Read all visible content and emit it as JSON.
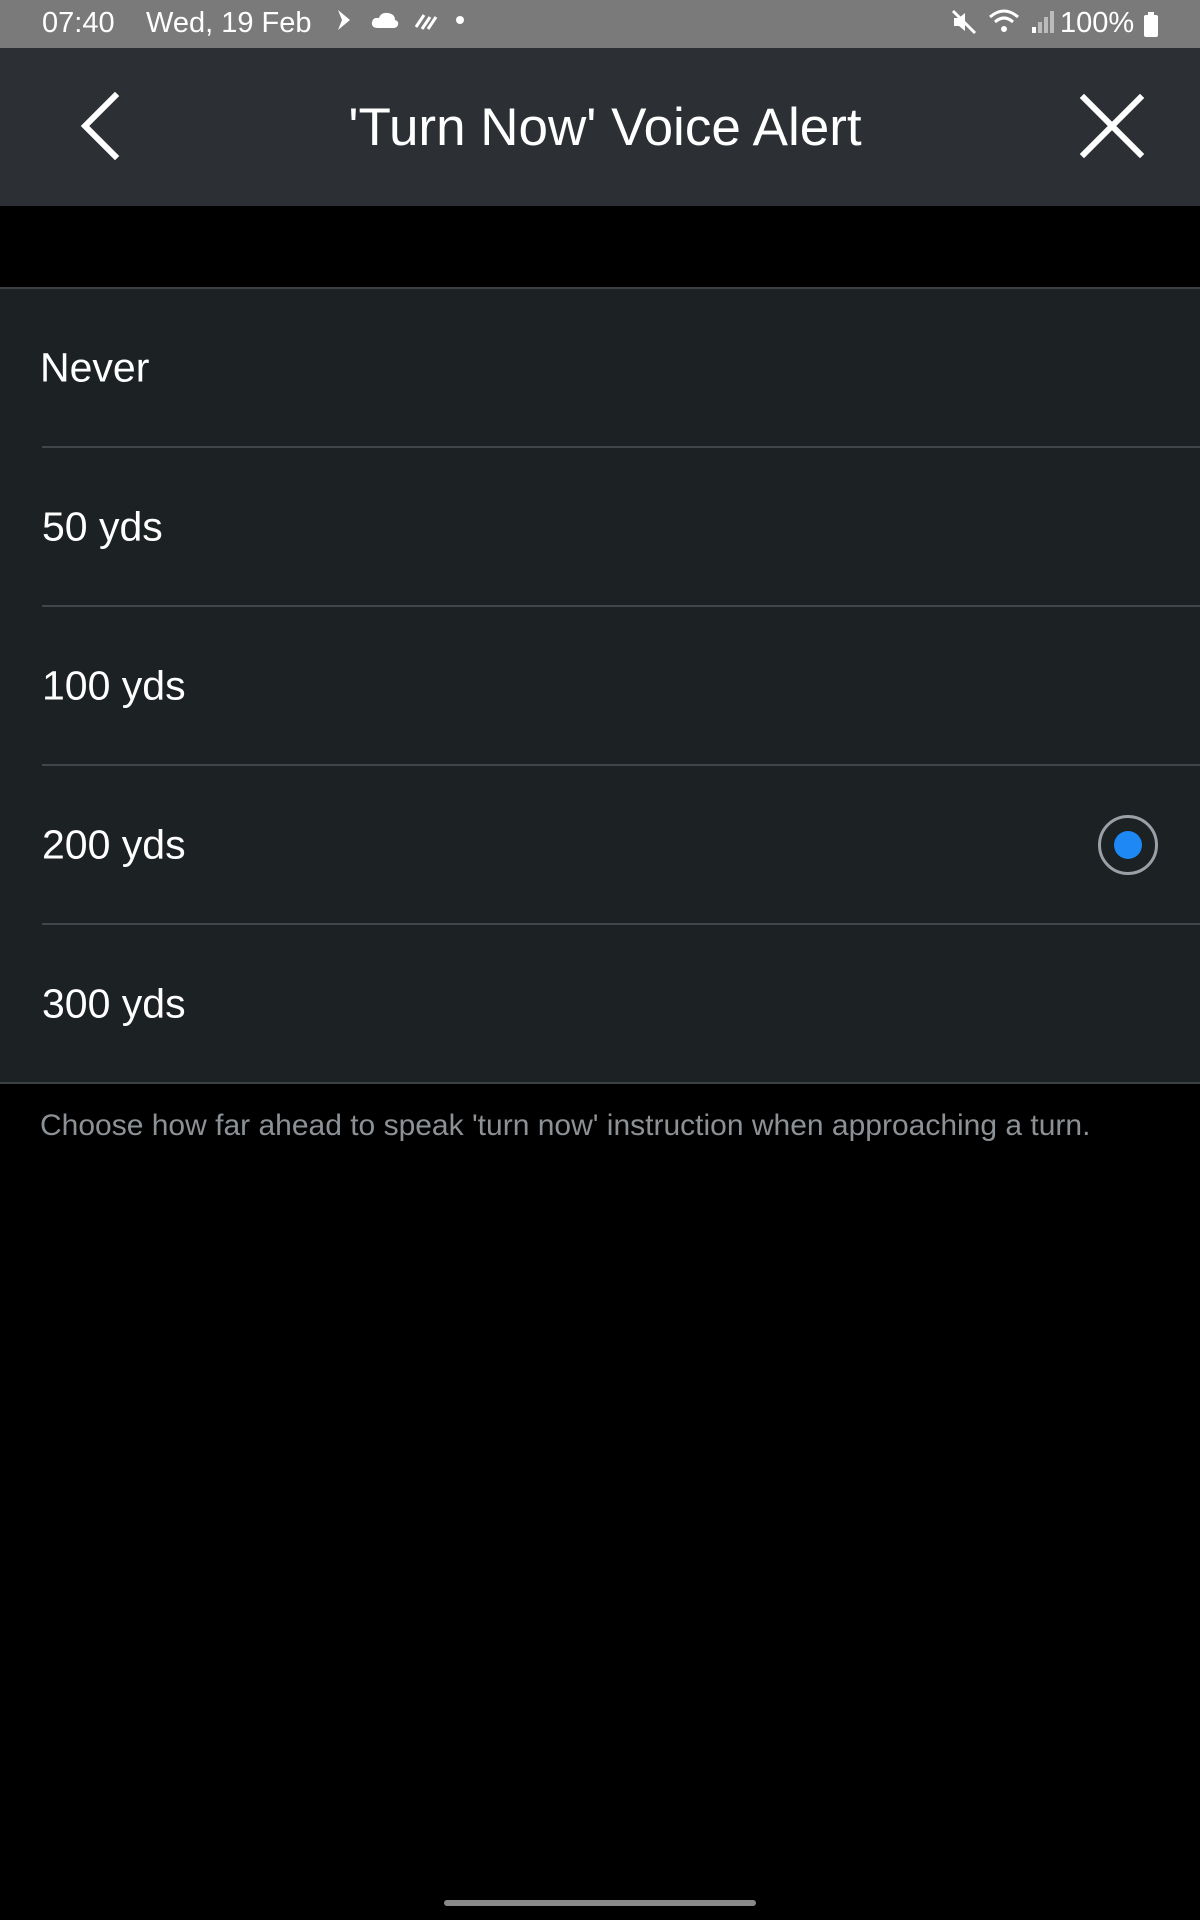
{
  "status_bar": {
    "time": "07:40",
    "date": "Wed, 19 Feb",
    "battery": "100%",
    "icons": [
      "nav-arrow-icon",
      "cloud-icon",
      "signal-waves-icon",
      "dot-icon",
      "mute-icon",
      "wifi-icon",
      "cell-signal-icon",
      "battery-icon"
    ]
  },
  "app_bar": {
    "title": "'Turn Now' Voice Alert",
    "back_icon": "chevron-left-icon",
    "close_icon": "close-icon"
  },
  "options": [
    {
      "label": "Never",
      "selected": false
    },
    {
      "label": "50 yds",
      "selected": false
    },
    {
      "label": "100 yds",
      "selected": false
    },
    {
      "label": "200 yds",
      "selected": true
    },
    {
      "label": "300 yds",
      "selected": false
    }
  ],
  "description": "Choose how far ahead to speak 'turn now' instruction when approaching a turn.",
  "colors": {
    "status_bar_bg": "#7a7a7a",
    "app_bar_bg": "#2c3035",
    "list_bg": "#1c2124",
    "accent": "#1e88f5",
    "description_text": "#8c9196"
  }
}
